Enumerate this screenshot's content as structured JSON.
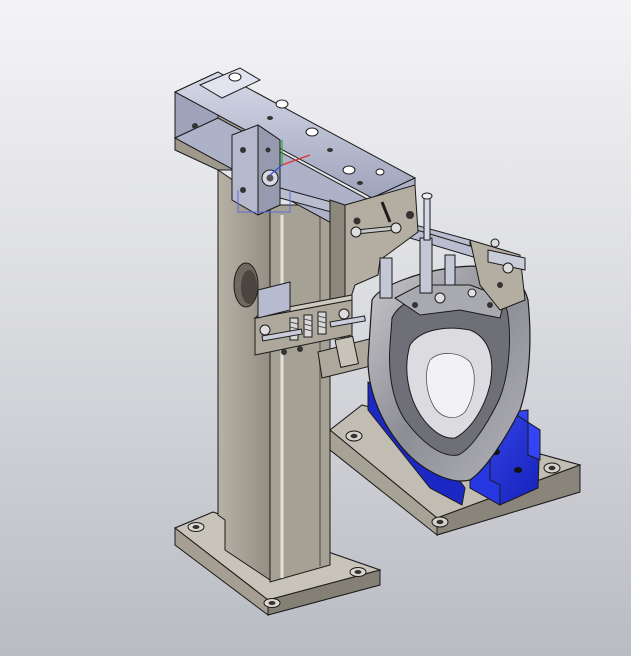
{
  "viewport": {
    "background_top": "#f4f4f6",
    "background_bottom": "#b9bcc3"
  },
  "colors": {
    "steel": "#a9a398",
    "steel_light": "#c9c4ba",
    "steel_dark": "#7f7a70",
    "cylinder": "#b7bbcf",
    "cylinder_light": "#d4d7e6",
    "nest_blue": "#1f2fd8",
    "part_gray": "#9a9aa2",
    "edge": "#1b1b1b"
  },
  "icons": {
    "triad": "coordinate-triad-icon"
  }
}
